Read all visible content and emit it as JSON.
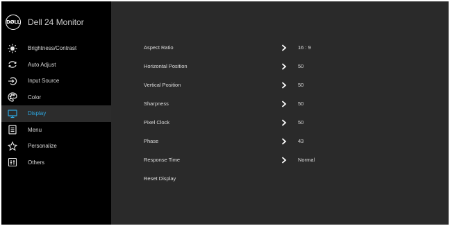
{
  "brand": {
    "logo_text": "DØLL",
    "title": "Dell 24 Monitor"
  },
  "sidebar": {
    "items": [
      {
        "label": "Brightness/Contrast",
        "icon": "sun-icon",
        "active": false
      },
      {
        "label": "Auto Adjust",
        "icon": "auto-adjust-arrows-icon",
        "active": false
      },
      {
        "label": "Input Source",
        "icon": "input-source-icon",
        "active": false
      },
      {
        "label": "Color",
        "icon": "palette-icon",
        "active": false
      },
      {
        "label": "Display",
        "icon": "monitor-icon",
        "active": true
      },
      {
        "label": "Menu",
        "icon": "menu-list-icon",
        "active": false
      },
      {
        "label": "Personalize",
        "icon": "star-icon",
        "active": false
      },
      {
        "label": "Others",
        "icon": "sliders-icon",
        "active": false
      }
    ]
  },
  "settings": [
    {
      "label": "Aspect Ratio",
      "value": "16 : 9",
      "has_chevron": true
    },
    {
      "label": "Horizontal Position",
      "value": "50",
      "has_chevron": true
    },
    {
      "label": "Vertical Position",
      "value": "50",
      "has_chevron": true
    },
    {
      "label": "Sharpness",
      "value": "50",
      "has_chevron": true
    },
    {
      "label": "Pixel Clock",
      "value": "50",
      "has_chevron": true
    },
    {
      "label": "Phase",
      "value": "43",
      "has_chevron": true
    },
    {
      "label": "Response Time",
      "value": "Normal",
      "has_chevron": true
    },
    {
      "label": "Reset Display",
      "value": "",
      "has_chevron": false
    }
  ],
  "colors": {
    "accent": "#2ea7e0",
    "sidebar_bg": "#000000",
    "panel_bg": "#2a2a2a",
    "text": "#dedede"
  }
}
